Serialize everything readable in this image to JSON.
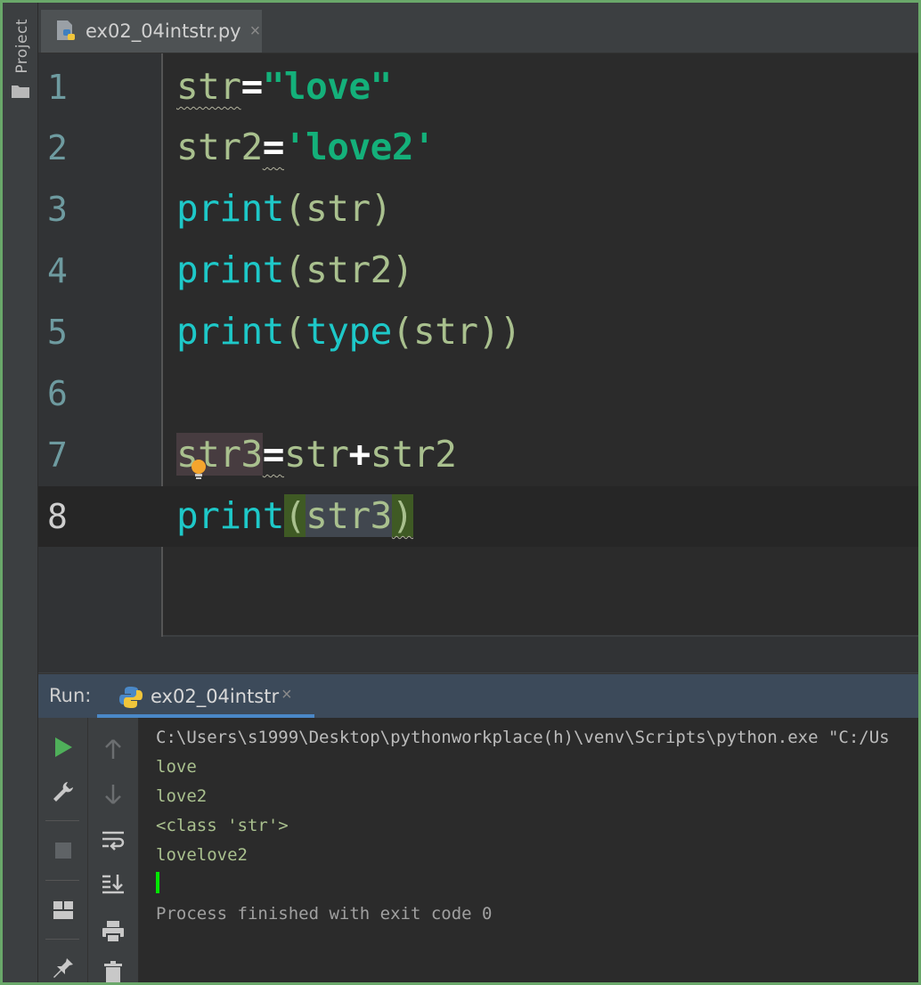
{
  "sidebar": {
    "project_label": "Project"
  },
  "editor_tab": {
    "filename": "ex02_04intstr.py",
    "close": "×"
  },
  "editor": {
    "line_numbers": [
      "1",
      "2",
      "3",
      "4",
      "5",
      "6",
      "7",
      "8"
    ]
  },
  "run": {
    "label": "Run:",
    "tab_name": "ex02_04intstr",
    "tab_close": "×"
  },
  "console": {
    "command": "C:\\Users\\s1999\\Desktop\\pythonworkplace(h)\\venv\\Scripts\\python.exe \"C:/Us",
    "output": [
      "love",
      "love2",
      "<class 'str'>",
      "lovelove2"
    ],
    "finished": "Process finished with exit code 0"
  },
  "colors": {
    "keyword": "#1ec8c8",
    "string": "#14b07a",
    "identifier": "#a9c08e",
    "run_button": "#4fb05a",
    "cursor": "#00e600"
  },
  "icons": [
    "folder-icon",
    "python-file-icon",
    "run-icon",
    "wrench-icon",
    "stop-icon",
    "layout-icon",
    "pin-icon",
    "up-arrow-icon",
    "down-arrow-icon",
    "soft-wrap-icon",
    "scroll-to-end-icon",
    "print-icon",
    "trash-icon",
    "lightbulb-icon"
  ]
}
